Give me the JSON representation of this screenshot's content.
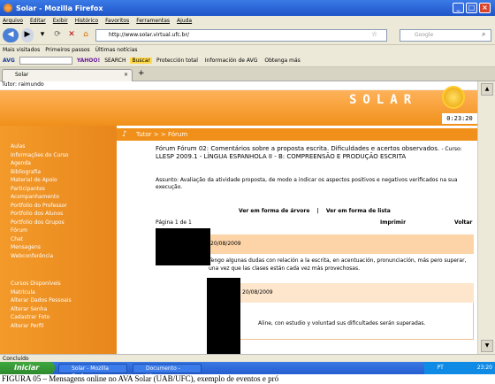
{
  "window": {
    "title": "Solar - Mozilla Firefox"
  },
  "menu": [
    "Arquivo",
    "Editar",
    "Exibir",
    "Histórico",
    "Favoritos",
    "Ferramentas",
    "Ajuda"
  ],
  "nav": {
    "url": "http://www.solar.virtual.ufc.br/",
    "search_placeholder": "Google"
  },
  "bookmarks": [
    "Mais visitados",
    "Primeiros passos",
    "Últimas notícias"
  ],
  "avgbar": {
    "brand": "AVG",
    "search": "SEARCH",
    "buscar": "Buscar",
    "items": [
      "Protección total",
      "Información de AVG",
      "Obtenga más"
    ]
  },
  "tab": {
    "label": "Solar"
  },
  "user": {
    "line": "Tutor: raimundo"
  },
  "header": {
    "logo": "SOLAR",
    "clock": "0:23:20"
  },
  "sidebar": {
    "group1": [
      "Aulas",
      "Informações do Curso",
      "Agenda",
      "Bibliografia",
      "Material de Apoio",
      "Participantes",
      "Acompanhamento",
      "Portfolio do Professor",
      "Portfolio dos Alunos",
      "Portfolio dos Grupos",
      "Fórum",
      "Chat",
      "Mensagens",
      "Webconferência"
    ],
    "group2": [
      "Cursos Disponíveis",
      "Matrícula",
      "Alterar Dados Pessoais",
      "Alterar Senha",
      "Cadastrar Foto",
      "Alterar Perfil"
    ]
  },
  "breadcrumb": "Tutor > > Fórum",
  "forum": {
    "title": "Fórum Fórum 02: Comentários sobre a proposta escrita. Dificuldades e acertos observados.",
    "curso_label": "- Curso:",
    "curso": "LLESP 2009.1 - LÍNGUA ESPANHOLA II - B: COMPREENSÃO E PRODUÇÃO ESCRITA",
    "assunto": "Assunto: Avaliação da atividade proposta, de modo a indicar os aspectos positivos e negativos verificados na sua execução.",
    "view_tree": "Ver em forma de árvore",
    "separator": "|",
    "view_list": "Ver em forma de lista",
    "page_info": "Página 1 de 1",
    "print": "Imprimir",
    "back": "Voltar",
    "posts": [
      {
        "date": "20/08/2009",
        "text": "Tengo algunas dudas con relación a la escrita, en acentuación, pronunciación, más pero superar, una vez que las clases están cada vez más provechosas."
      },
      {
        "date": "20/08/2009",
        "text": "Aline, con estudio y voluntad sus dificultades serán superadas."
      }
    ]
  },
  "status": "Concluído",
  "taskbar": {
    "start": "Iniciar",
    "tasks": [
      "Solar - Mozilla Firefox",
      "Documento - Micro..."
    ],
    "time": "23:20",
    "lang": "PT"
  },
  "caption": "FIGURA 05 – Mensagens online no AVA Solar (UAB/UFC), exemplo de eventos e pró"
}
